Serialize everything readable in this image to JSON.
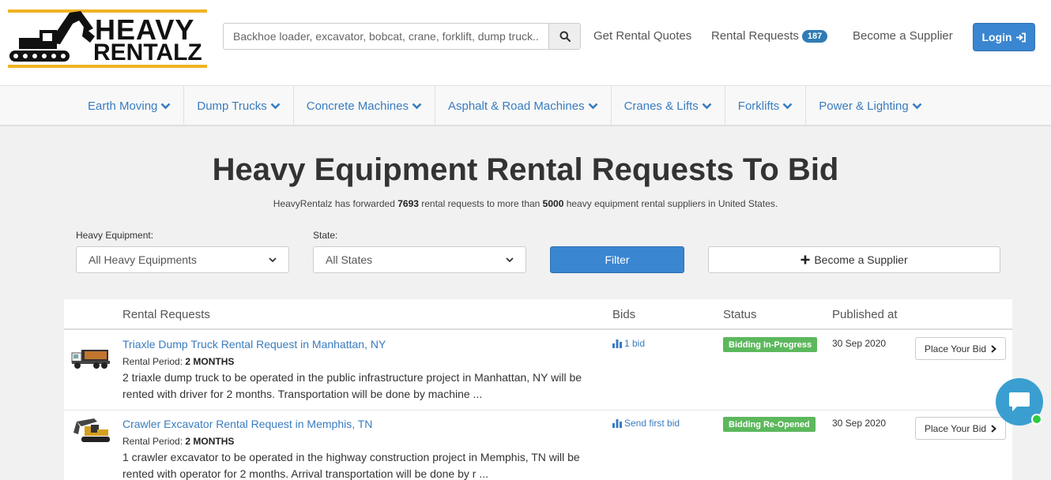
{
  "header": {
    "logo_line1": "HEAVY",
    "logo_line2": "RENTALZ",
    "search_placeholder": "Backhoe loader, excavator, bobcat, crane, forklift, dump truck...",
    "nav": {
      "quotes": "Get Rental Quotes",
      "requests": "Rental Requests",
      "requests_count": "187",
      "supplier": "Become a Supplier",
      "login": "Login"
    }
  },
  "categories": [
    "Earth Moving",
    "Dump Trucks",
    "Concrete Machines",
    "Asphalt & Road Machines",
    "Cranes & Lifts",
    "Forklifts",
    "Power & Lighting"
  ],
  "page": {
    "title": "Heavy Equipment Rental Requests To Bid",
    "subtitle_pre": "HeavyRentalz has forwarded ",
    "forwarded_count": "7693",
    "subtitle_mid": " rental requests to more than ",
    "supplier_count": "5000",
    "subtitle_post": " heavy equipment rental suppliers in United States."
  },
  "filters": {
    "equipment_label": "Heavy Equipment:",
    "equipment_value": "All Heavy Equipments",
    "state_label": "State:",
    "state_value": "All States",
    "filter_button": "Filter",
    "supplier_button": "Become a Supplier"
  },
  "table": {
    "headers": {
      "requests": "Rental Requests",
      "bids": "Bids",
      "status": "Status",
      "published": "Published at"
    },
    "rows": [
      {
        "title": "Triaxle Dump Truck Rental Request in Manhattan, NY",
        "period_label": "Rental Period: ",
        "period": "2 MONTHS",
        "desc": "2 triaxle dump truck to be operated in the public infrastructure project in Manhattan, NY will be rented with driver for 2 months. Transportation will be done by machine ...",
        "bids": "1 bid",
        "status": "Bidding In-Progress",
        "published": "30 Sep 2020",
        "button": "Place Your Bid"
      },
      {
        "title": "Crawler Excavator Rental Request in Memphis, TN",
        "period_label": "Rental Period: ",
        "period": "2 MONTHS",
        "desc": "1 crawler excavator to be operated in the highway construction project in Memphis, TN will be rented with operator for 2 months. Arrival transportation will be done by r ...",
        "bids": "Send first bid",
        "status": "Bidding Re-Opened",
        "published": "30 Sep 2020",
        "button": "Place Your Bid"
      }
    ]
  },
  "colors": {
    "accent": "#3a86d0",
    "link": "#3a7cbf",
    "status_green": "#5cb85c",
    "logo_yellow": "#f0b323"
  }
}
